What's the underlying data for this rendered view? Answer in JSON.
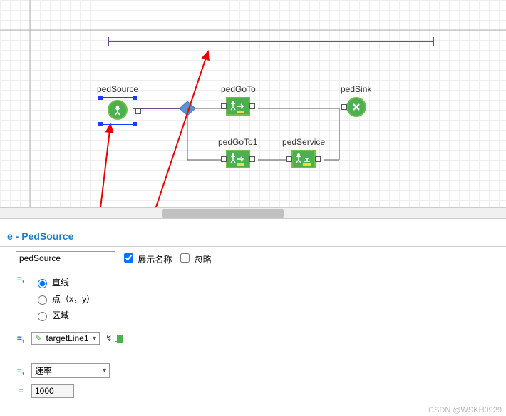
{
  "canvas": {
    "nodes": {
      "pedSource": {
        "label": "pedSource"
      },
      "pedGoTo": {
        "label": "pedGoTo"
      },
      "pedGoTo1": {
        "label": "pedGoTo1"
      },
      "pedService": {
        "label": "pedService"
      },
      "pedSink": {
        "label": "pedSink"
      }
    }
  },
  "panel": {
    "title": "e - PedSource",
    "name_value": "pedSource",
    "show_name_label": "展示名称",
    "show_name_checked": true,
    "ignore_label": "忽略",
    "ignore_checked": false,
    "arrival_mode": {
      "option_line": "直线",
      "option_point": "点（x，y）",
      "option_area": "区域",
      "selected": "line"
    },
    "target_line_value": "targetLine1",
    "rate_label": "速率",
    "rate_value": "1000"
  },
  "watermark": "CSDN @WSKH0929"
}
